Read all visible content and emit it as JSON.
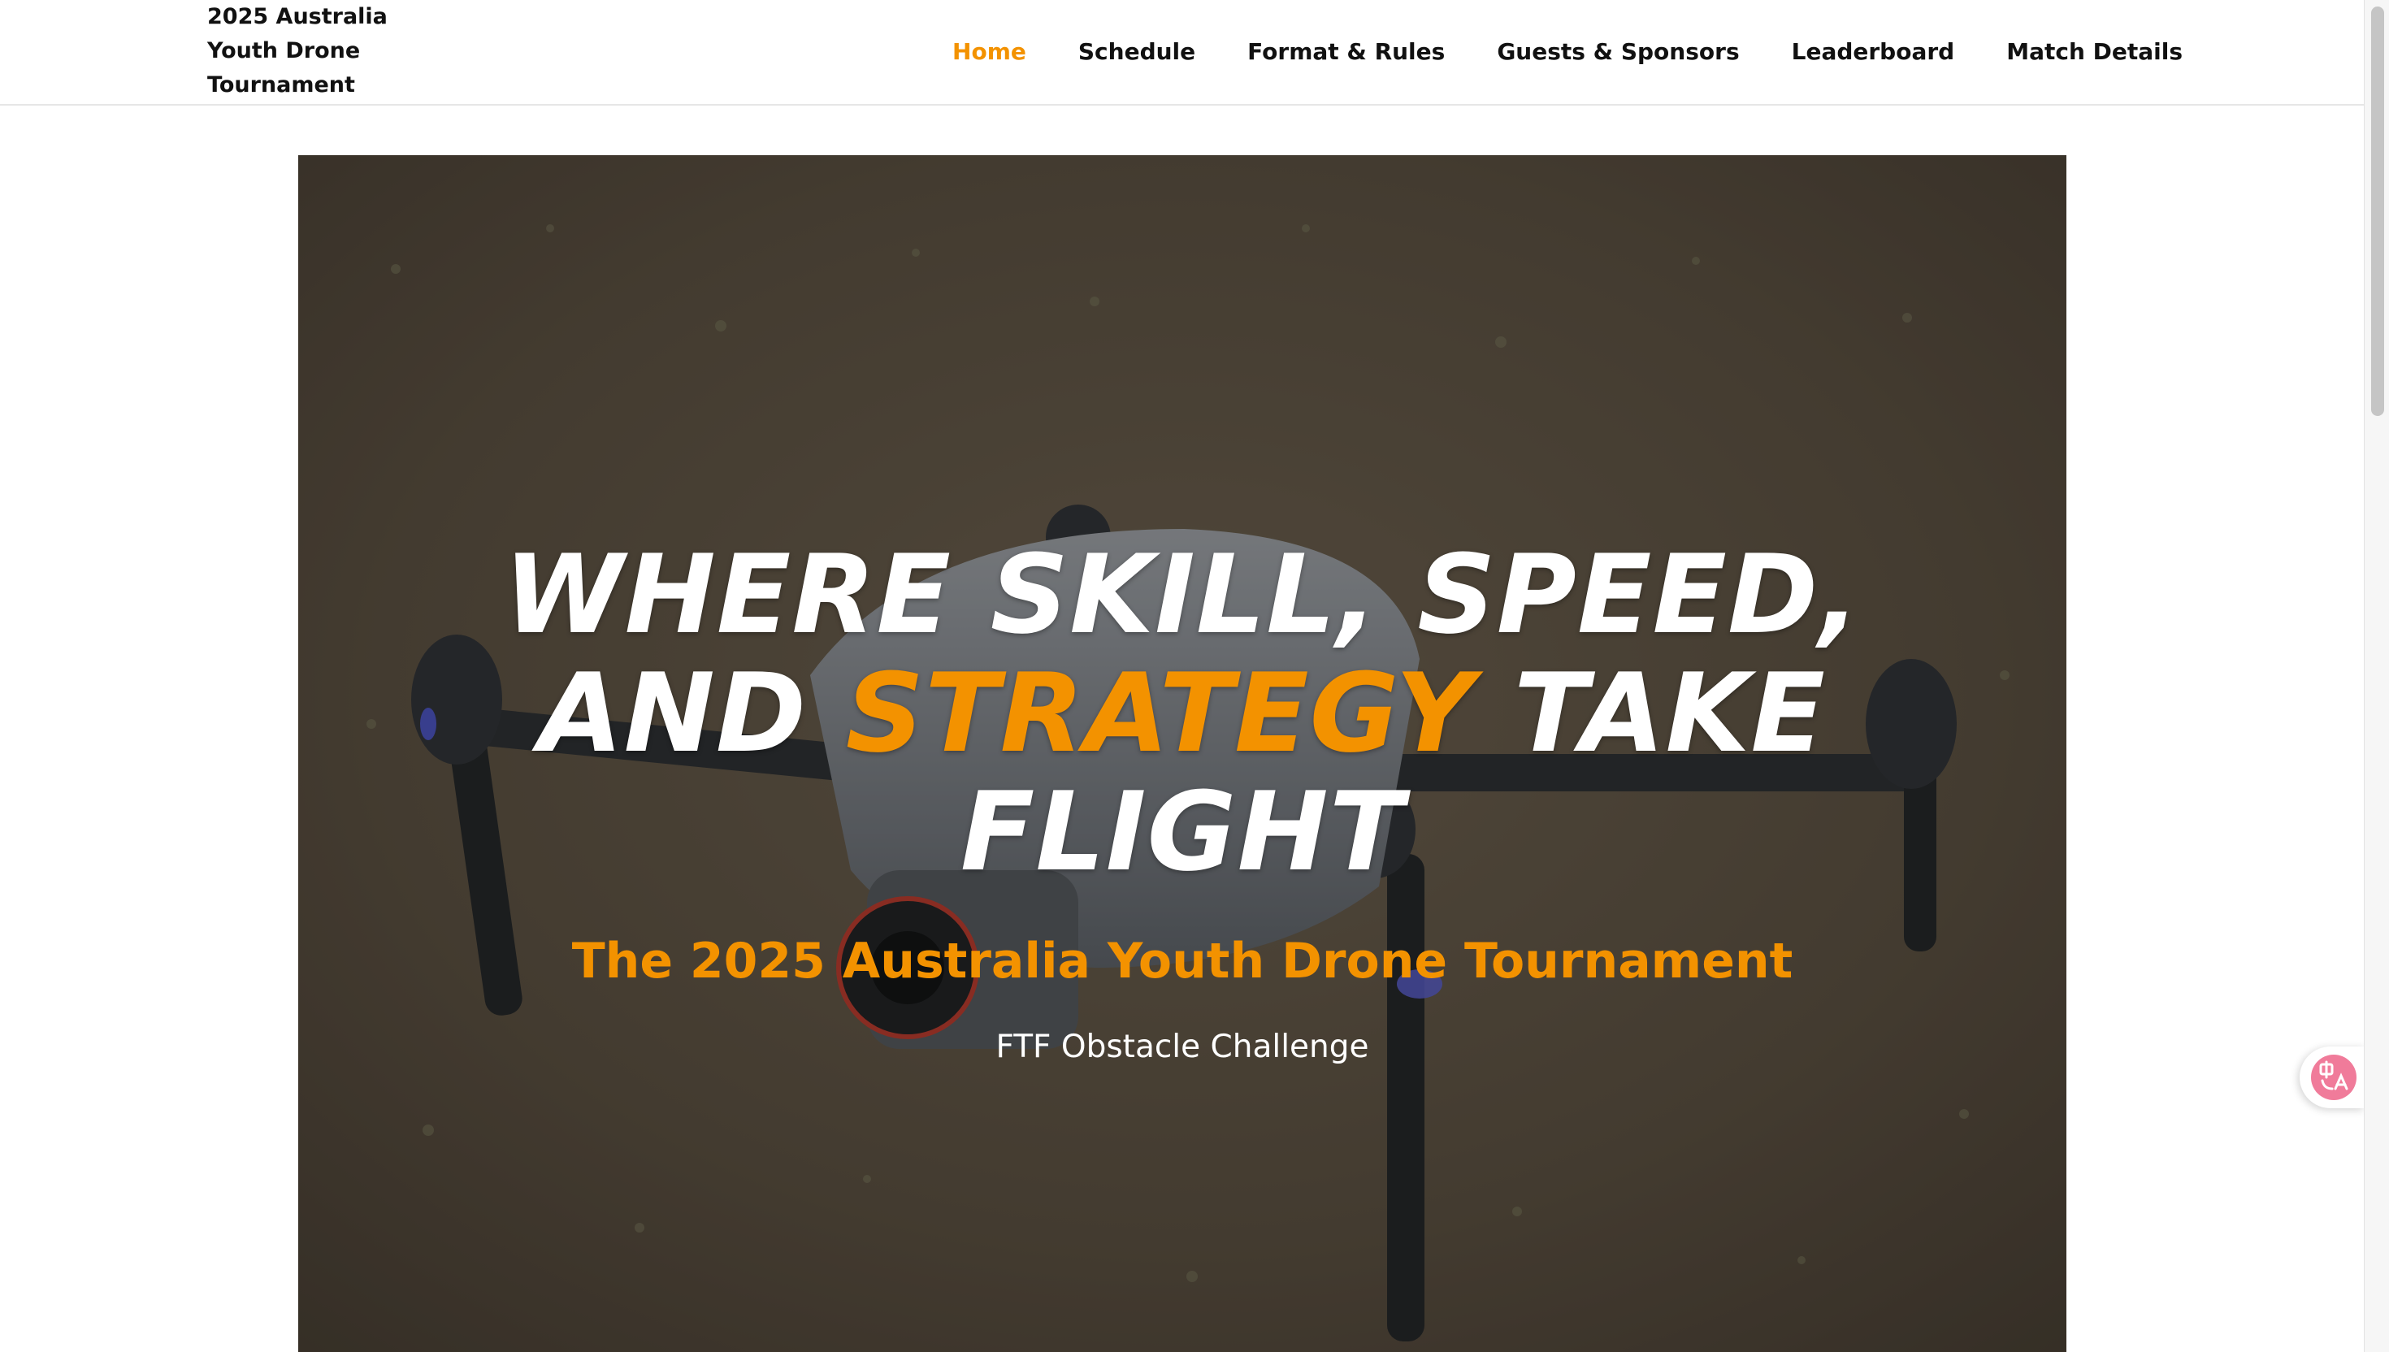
{
  "header": {
    "brand": "2025 Australia\nYouth Drone\nTournament",
    "nav": [
      {
        "label": "Home",
        "active": true
      },
      {
        "label": "Schedule",
        "active": false
      },
      {
        "label": "Format & Rules",
        "active": false
      },
      {
        "label": "Guests & Sponsors",
        "active": false
      },
      {
        "label": "Leaderboard",
        "active": false
      },
      {
        "label": "Match Details",
        "active": false
      }
    ]
  },
  "hero": {
    "headline": {
      "line1": "WHERE SKILL, SPEED,",
      "line2_start": "AND",
      "line2_accent": "STRATEGY",
      "line2_end": "TAKE",
      "line3": "FLIGHT"
    },
    "subtitle": "The 2025 Australia Youth Drone Tournament",
    "tagline": "FTF Obstacle Challenge",
    "image_icon": "drone-photo"
  },
  "widgets": {
    "translate_icon": "translate-icon"
  },
  "colors": {
    "accent": "#f39200",
    "text_dark": "#111111",
    "text_light": "#ffffff",
    "translate_pink": "#f07b9a"
  }
}
